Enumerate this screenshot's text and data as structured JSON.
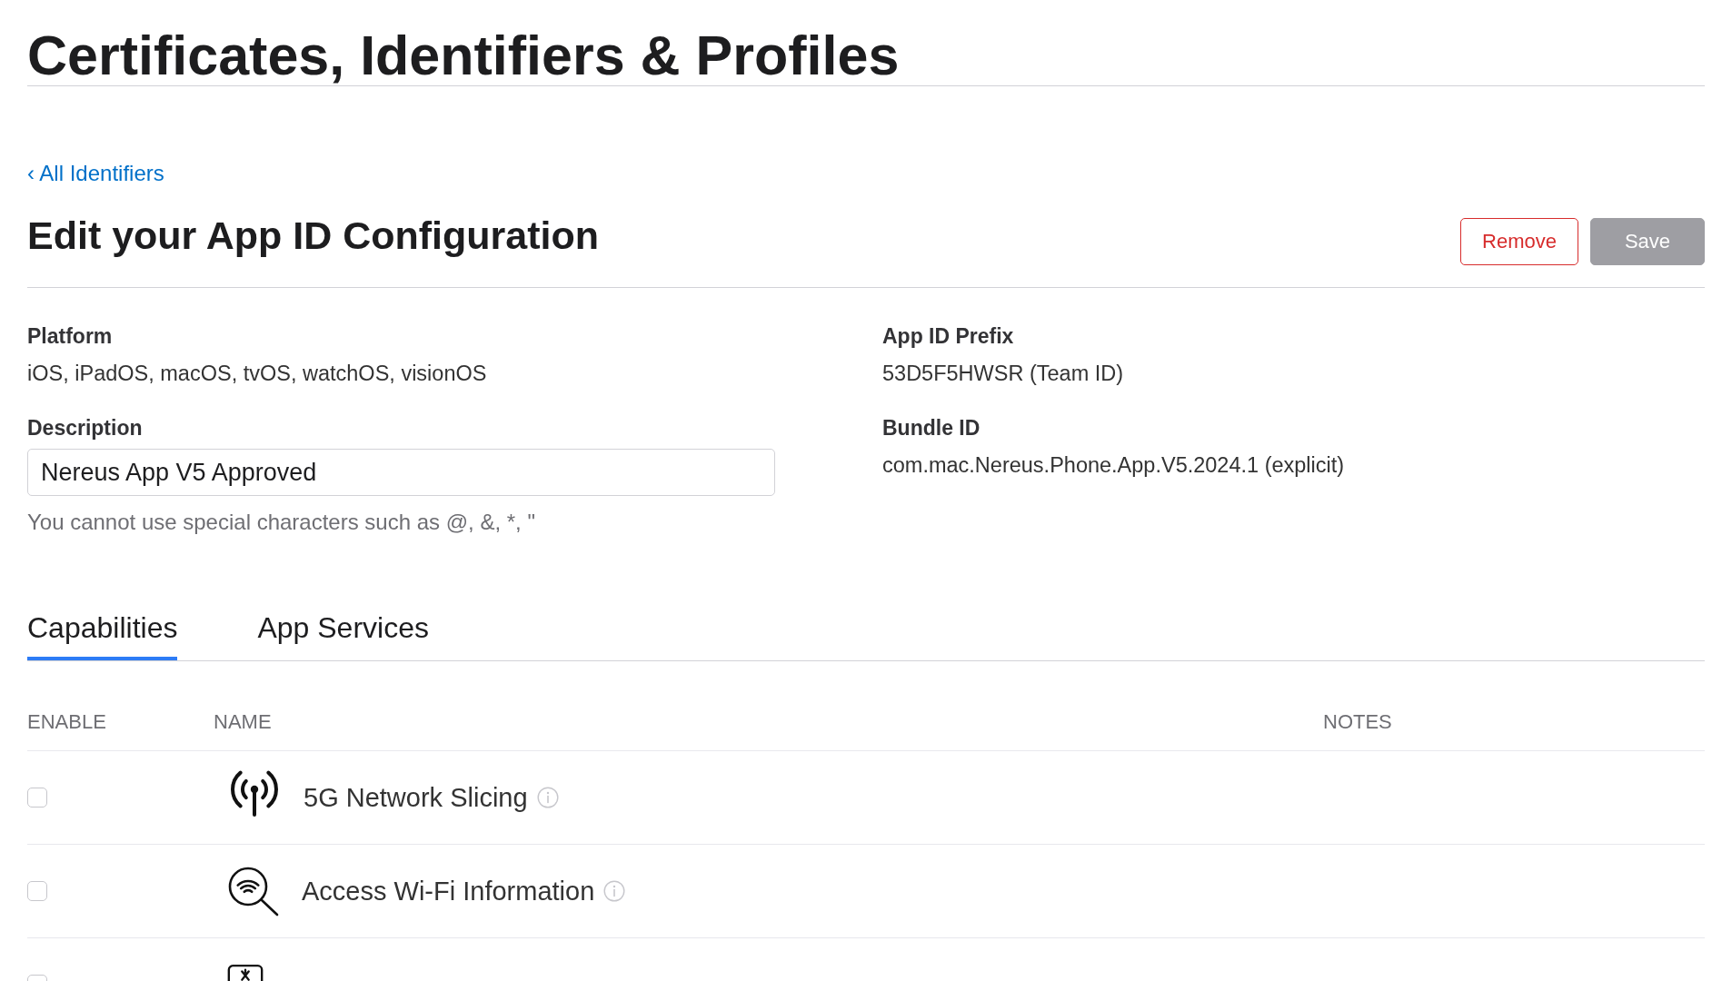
{
  "header": {
    "title": "Certificates, Identifiers & Profiles"
  },
  "back_link": {
    "label": "‹ All Identifiers"
  },
  "form": {
    "title": "Edit your App ID Configuration",
    "buttons": [
      {
        "label": "Remove",
        "kind": "destructive",
        "disabled": false
      },
      {
        "label": "Save",
        "kind": "primary",
        "disabled": true
      }
    ]
  },
  "details": {
    "columns": [
      {
        "fields": [
          {
            "kind": "text",
            "label": "Platform",
            "value": "iOS, iPadOS, macOS, tvOS, watchOS, visionOS"
          },
          {
            "kind": "input",
            "label": "Description",
            "value": "Nereus App V5 Approved",
            "help_text": "You cannot use special characters such as @, &, *, \""
          }
        ]
      },
      {
        "fields": [
          {
            "kind": "text",
            "label": "App ID Prefix",
            "value": "53D5F5HWSR (Team ID)"
          },
          {
            "kind": "text",
            "label": "Bundle ID",
            "value": "com.mac.Nereus.Phone.App.V5.2024.1 (explicit)"
          }
        ]
      }
    ]
  },
  "tabs": [
    {
      "label": "Capabilities",
      "selected": true
    },
    {
      "label": "App Services",
      "selected": false
    }
  ],
  "table": {
    "columns": [
      "ENABLE",
      "NAME",
      "NOTES"
    ],
    "rows": [
      {
        "checked": false,
        "name": "5G Network Slicing"
      },
      {
        "checked": false,
        "name": "Access Wi-Fi Information"
      },
      {
        "checked": false
      }
    ]
  }
}
